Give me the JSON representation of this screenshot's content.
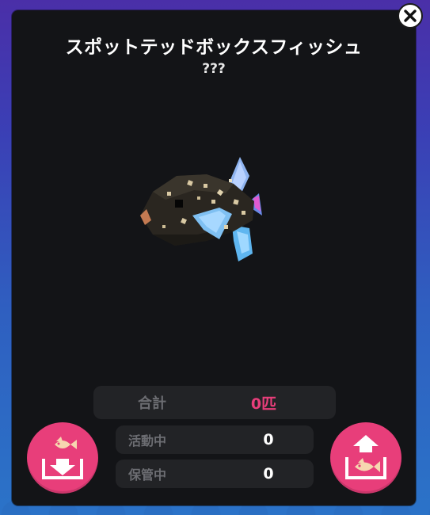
{
  "fish": {
    "name": "スポットテッドボックスフィッシュ",
    "subtitle": "???"
  },
  "stats": {
    "total_label": "合計",
    "total_value": "0匹",
    "active_label": "活動中",
    "active_value": "0",
    "stored_label": "保管中",
    "stored_value": "0"
  },
  "icons": {
    "close": "close-icon",
    "store": "fish-down-tray-icon",
    "release": "fish-up-tray-icon"
  },
  "colors": {
    "accent": "#e83e7a",
    "panel": "#131417",
    "stat_bg": "#222326",
    "label": "#6c6d72"
  }
}
